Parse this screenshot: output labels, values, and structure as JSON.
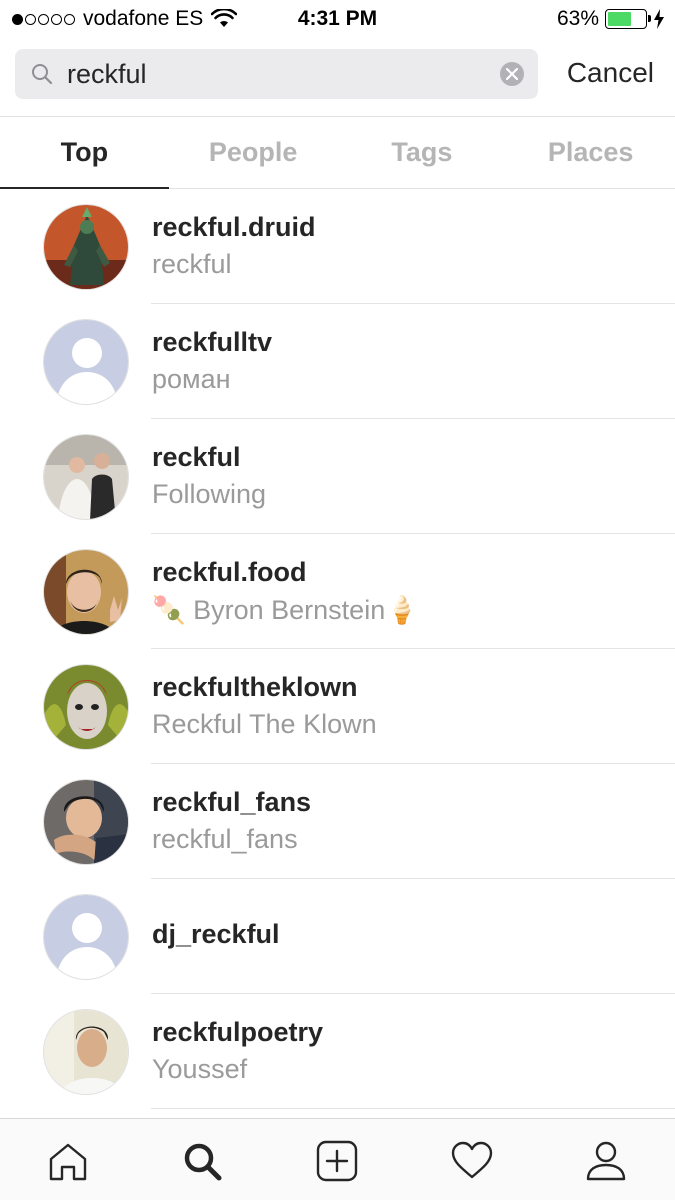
{
  "status_bar": {
    "carrier": "vodafone ES",
    "time": "4:31 PM",
    "battery": "63%",
    "battery_level": 0.63
  },
  "search": {
    "query": "reckful",
    "placeholder": "Search",
    "cancel_label": "Cancel"
  },
  "tabs": [
    {
      "label": "Top",
      "active": true
    },
    {
      "label": "People",
      "active": false
    },
    {
      "label": "Tags",
      "active": false
    },
    {
      "label": "Places",
      "active": false
    }
  ],
  "results": [
    {
      "username": "reckful.druid",
      "fullname": "reckful"
    },
    {
      "username": "reckfulltv",
      "fullname": "роман"
    },
    {
      "username": "reckful",
      "fullname": "Following"
    },
    {
      "username": "reckful.food",
      "fullname": "🍡 Byron Bernstein🍦"
    },
    {
      "username": "reckfultheklown",
      "fullname": "Reckful The Klown"
    },
    {
      "username": "reckful_fans",
      "fullname": "reckful_fans"
    },
    {
      "username": "dj_reckful",
      "fullname": ""
    },
    {
      "username": "reckfulpoetry",
      "fullname": "Youssef"
    }
  ],
  "bottom_nav": [
    "home-icon",
    "search-icon",
    "add-post-icon",
    "heart-icon",
    "profile-icon"
  ]
}
